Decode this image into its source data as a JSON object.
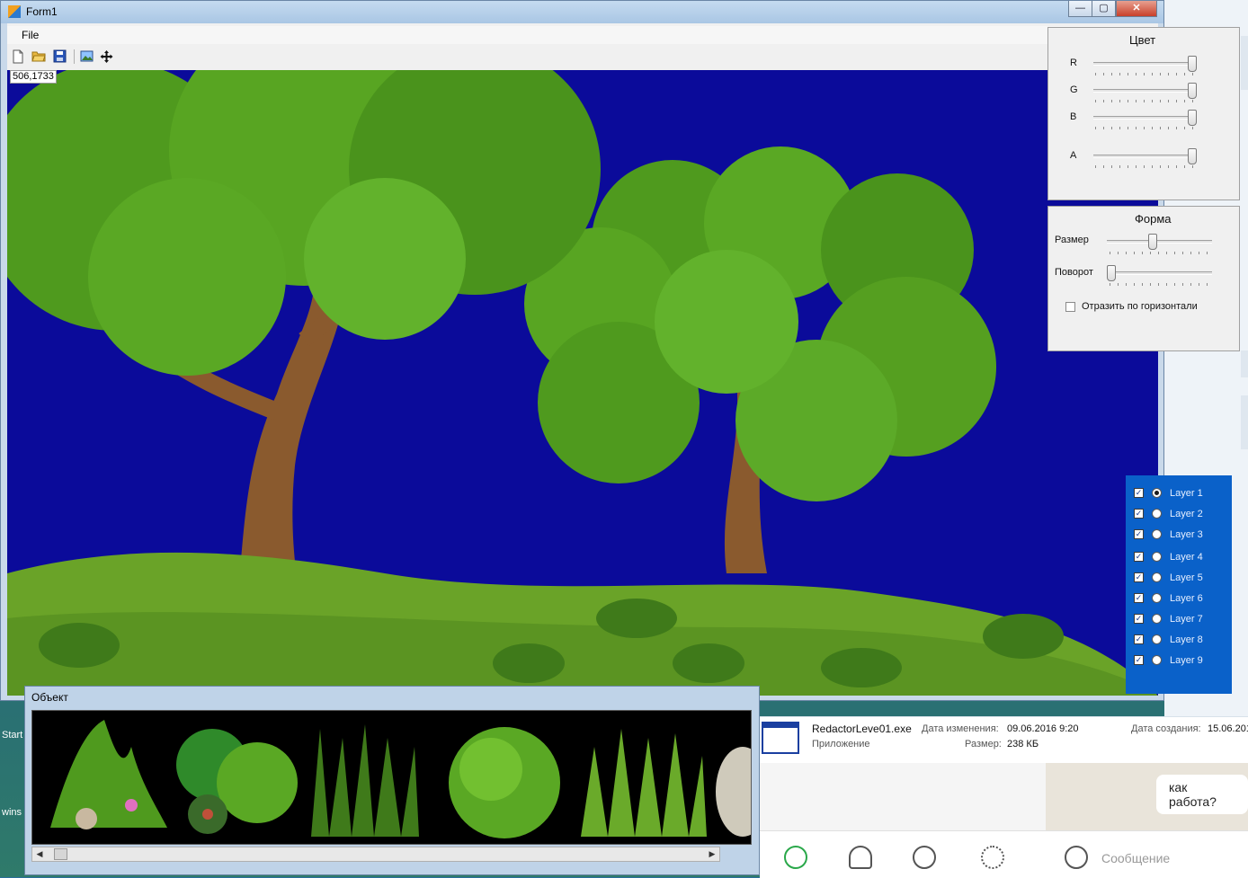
{
  "window": {
    "title": "Form1",
    "minimize_glyph": "—",
    "maximize_glyph": "▢",
    "close_glyph": "✕"
  },
  "menu": {
    "file": "File"
  },
  "toolbar": {
    "new_icon": "new-file-icon",
    "open_icon": "open-folder-icon",
    "save_icon": "save-disk-icon",
    "image_icon": "image-icon",
    "move_icon": "move-arrows-icon"
  },
  "status": {
    "coords": "506,1733"
  },
  "color_panel": {
    "title": "Цвет",
    "sliders": [
      {
        "label": "R",
        "value": 255
      },
      {
        "label": "G",
        "value": 255
      },
      {
        "label": "B",
        "value": 255
      },
      {
        "label": "A",
        "value": 255
      }
    ]
  },
  "shape_panel": {
    "title": "Форма",
    "size_label": "Размер",
    "size_value": 0.43,
    "rotation_label": "Поворот",
    "rotation_value": 0.0,
    "flip_label": "Отразить по горизонтали",
    "flip_checked": false
  },
  "layers": [
    {
      "label": "Layer 1",
      "visible": true,
      "active": true
    },
    {
      "label": "Layer 2",
      "visible": true,
      "active": false
    },
    {
      "label": "Layer 3",
      "visible": true,
      "active": false
    },
    {
      "label": "Layer 4",
      "visible": true,
      "active": false
    },
    {
      "label": "Layer 5",
      "visible": true,
      "active": false
    },
    {
      "label": "Layer 6",
      "visible": true,
      "active": false
    },
    {
      "label": "Layer 7",
      "visible": true,
      "active": false
    },
    {
      "label": "Layer 8",
      "visible": true,
      "active": false
    },
    {
      "label": "Layer 9",
      "visible": true,
      "active": false
    }
  ],
  "object_window": {
    "title": "Объект"
  },
  "explorer": {
    "file_name": "RedactorLeve01.exe",
    "file_type": "Приложение",
    "modified_label": "Дата изменения:",
    "modified_value": "09.06.2016 9:20",
    "size_label": "Размер:",
    "size_value": "238 КБ",
    "created_label": "Дата создания:",
    "created_value": "15.06.201"
  },
  "desktop": {
    "start_label": "Start",
    "wins_label": "wins"
  },
  "chat": {
    "bubble": "как работа?",
    "input_placeholder": "Сообщение"
  },
  "colors": {
    "canvas_bg": "#0b0b9a",
    "layers_bg": "#0a61c9",
    "grass": "#6aa328",
    "foliage": "#4f9a1e",
    "trunk": "#8a5a2e"
  }
}
